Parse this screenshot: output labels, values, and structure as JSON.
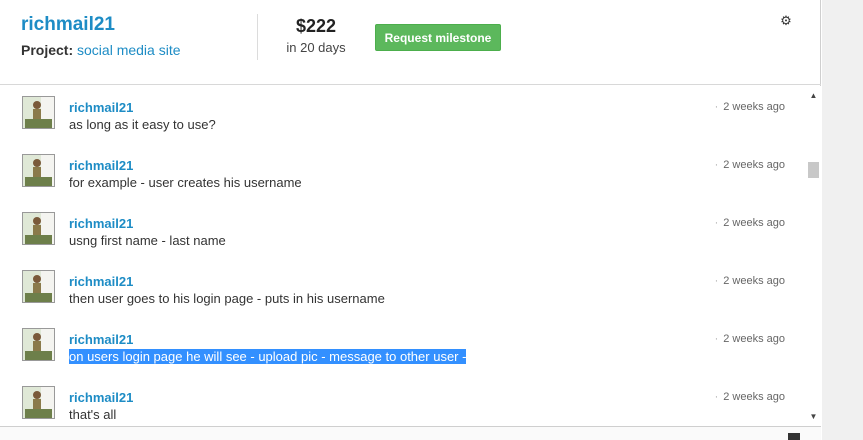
{
  "header": {
    "username": "richmail21",
    "project_label": "Project:",
    "project_name": "social media site",
    "amount": "$222",
    "duration": "in 20 days",
    "milestone_button": "Request milestone",
    "settings_icon": "gear-icon"
  },
  "messages": [
    {
      "user": "richmail21",
      "text": "as long as it easy to use?",
      "time": "2 weeks ago",
      "selected": false
    },
    {
      "user": "richmail21",
      "text": "for example - user creates his username",
      "time": "2 weeks ago",
      "selected": false
    },
    {
      "user": "richmail21",
      "text": "usng first name - last name",
      "time": "2 weeks ago",
      "selected": false
    },
    {
      "user": "richmail21",
      "text": "then user goes to his login page - puts in his username",
      "time": "2 weeks ago",
      "selected": false
    },
    {
      "user": "richmail21",
      "text": "on users login page he will see - upload pic - message to other user -",
      "time": "2 weeks ago",
      "selected": true
    },
    {
      "user": "richmail21",
      "text": "that's all",
      "time": "2 weeks ago",
      "selected": false
    }
  ],
  "colors": {
    "accent": "#1d8cc5",
    "button": "#5cb85c",
    "selection": "#3390ff"
  }
}
